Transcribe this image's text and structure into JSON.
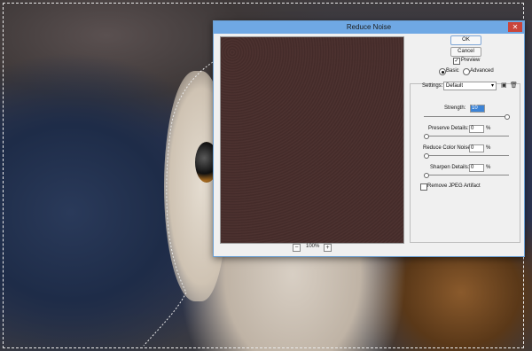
{
  "dialog": {
    "title": "Reduce Noise",
    "close_glyph": "✕",
    "ok_label": "OK",
    "cancel_label": "Cancel",
    "preview_label": "Preview",
    "preview_checked": true,
    "mode_basic": "Basic",
    "mode_advanced": "Advanced",
    "mode_selected": "Basic",
    "settings_label": "Settings:",
    "settings_value": "Default",
    "zoom_out": "−",
    "zoom_in": "+",
    "zoom_value": "100%",
    "strength_label": "Strength:",
    "strength_value": "10",
    "preserve_label": "Preserve Details:",
    "preserve_value": "0",
    "preserve_unit": "%",
    "color_noise_label": "Reduce Color Noise:",
    "color_noise_value": "0",
    "color_noise_unit": "%",
    "sharpen_label": "Sharpen Details:",
    "sharpen_value": "0",
    "sharpen_unit": "%",
    "jpeg_label": "Remove JPEG Artifact",
    "jpeg_checked": false,
    "icons": {
      "save": "floppy-icon",
      "delete": "trash-icon"
    },
    "colors": {
      "titlebar": "#6fa8e4",
      "close": "#c9453b",
      "field_highlight": "#3d84d6"
    }
  },
  "sliders": {
    "strength": 1.0,
    "preserve": 0.0,
    "color_noise": 0.0,
    "sharpen": 0.0
  }
}
